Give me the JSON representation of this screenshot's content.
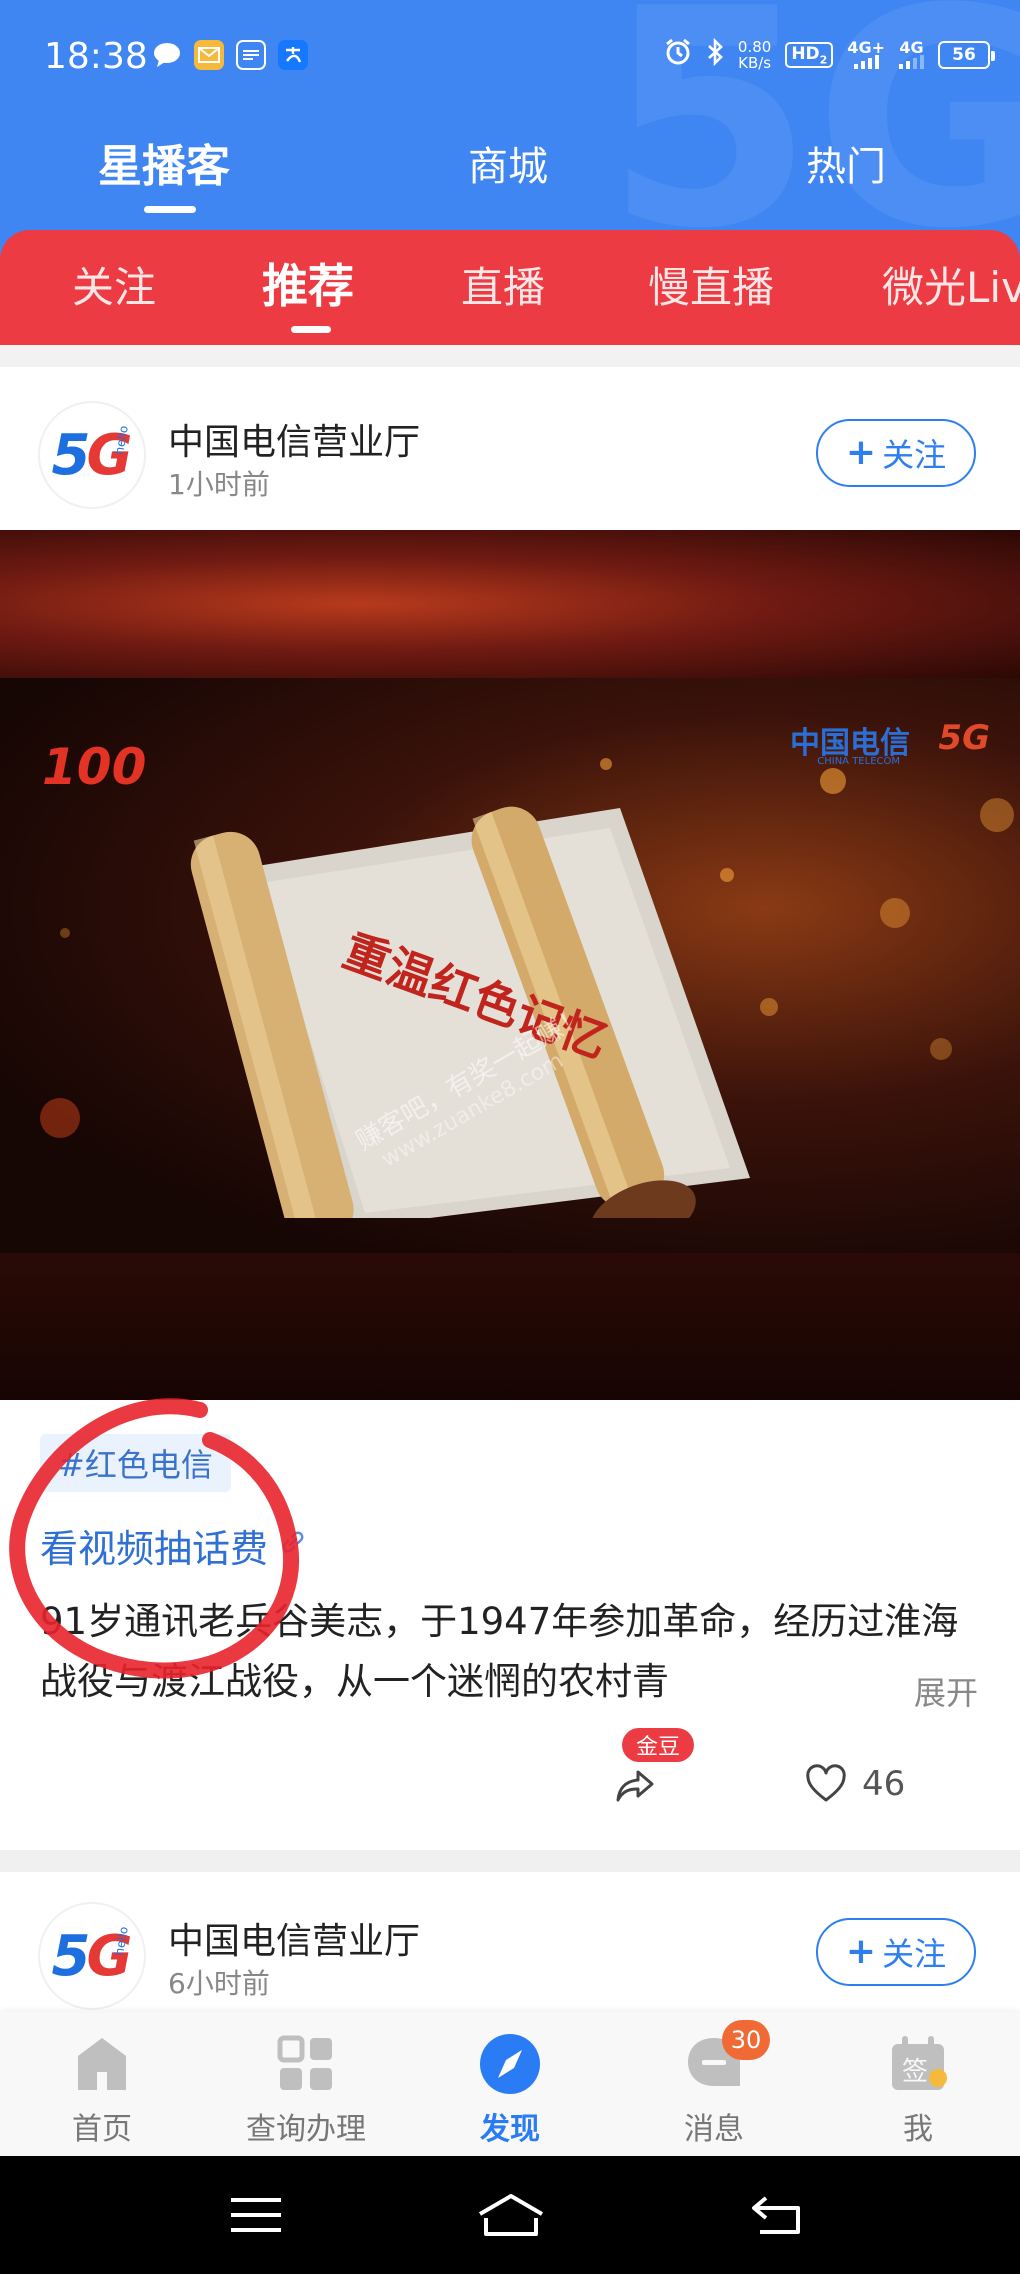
{
  "status_bar": {
    "time": "18:38",
    "net_speed_value": "0.80",
    "net_speed_unit": "KB/s",
    "hd_label": "HD",
    "hd_sub": "2",
    "signal1_label": "4G+",
    "signal2_label": "4G",
    "battery": "56",
    "notification_icons": [
      "chat-bubble-icon",
      "mail-icon",
      "message-icon",
      "alipay-icon"
    ]
  },
  "top_tabs": {
    "items": [
      {
        "label": "星播客",
        "active": true
      },
      {
        "label": "商城",
        "active": false
      },
      {
        "label": "热门",
        "active": false
      }
    ]
  },
  "sub_tabs": {
    "items": [
      {
        "label": "关注",
        "active": false
      },
      {
        "label": "推荐",
        "active": true
      },
      {
        "label": "直播",
        "active": false
      },
      {
        "label": "慢直播",
        "active": false
      },
      {
        "label": "微光Live",
        "active": false
      }
    ]
  },
  "post1": {
    "author": "中国电信营业厅",
    "time_ago": "1小时前",
    "follow_label": "关注",
    "video": {
      "title_text": "重温红色记忆",
      "watermark": "赚客吧，有奖一起赚！",
      "watermark_url": "www.zuanke8.com",
      "emblem": "100",
      "brand": "中国电信",
      "brand_sub": "CHINA TELECOM",
      "brand_5g": "5G"
    },
    "tag": "#红色电信",
    "link_text": "看视频抽话费",
    "body": "91岁通讯老兵谷美志，于1947年参加革命，经历过淮海战役与渡江战役，从一个迷惘的农村青",
    "expand_label": "展开",
    "gold_badge": "金豆",
    "like_count": "46"
  },
  "post2": {
    "author": "中国电信营业厅",
    "time_ago": "6小时前",
    "follow_label": "关注"
  },
  "avatar": {
    "five": "5",
    "g": "G",
    "hello": "hello"
  },
  "bottom_nav": {
    "items": [
      {
        "label": "首页",
        "icon": "home-icon",
        "active": false
      },
      {
        "label": "查询办理",
        "icon": "grid-icon",
        "active": false
      },
      {
        "label": "发现",
        "icon": "compass-icon",
        "active": true
      },
      {
        "label": "消息",
        "icon": "message-icon",
        "active": false,
        "badge": "30"
      },
      {
        "label": "我",
        "icon": "sign-in-calendar-icon",
        "active": false
      }
    ]
  },
  "colors": {
    "header_blue": "#3f86f3",
    "tab_red": "#ec3b43",
    "link_blue": "#2f6fd6",
    "active_nav_blue": "#2a7cf5",
    "badge_orange": "#f06a35"
  }
}
